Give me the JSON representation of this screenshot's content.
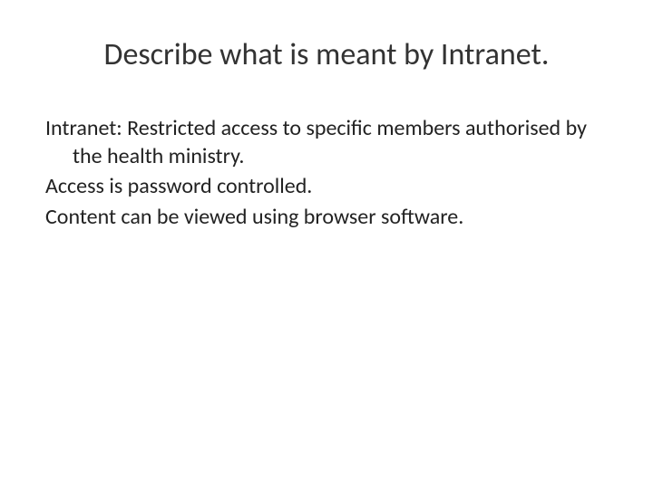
{
  "slide": {
    "title": "Describe what is meant by Intranet.",
    "paragraphs": [
      "Intranet: Restricted access to specific members authorised by the health ministry.",
      "Access is password controlled.",
      "Content can be viewed using browser software."
    ]
  }
}
